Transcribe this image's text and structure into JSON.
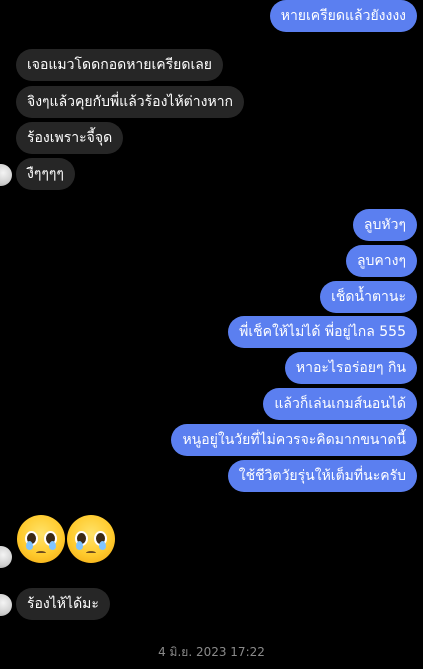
{
  "messages": {
    "m1": "หายเครียดแล้วยังงงง",
    "m2": "เจอแมวโดดกอดหายเครียดเลย",
    "m3": "จิงๆแล้วคุยกับพี่แล้วร้องไห้ต่างหาก",
    "m4": "ร้องเพราะจี้จุด",
    "m5": "งืๆๆๆๆ",
    "m6": "ลูบหัวๆ",
    "m7": "ลูบคางๆ",
    "m8": "เช็ดน้ำตานะ",
    "m9": "พี่เช็คให้ไม่ได้ พี่อยู่ไกล 555",
    "m10": "หาอะไรอร่อยๆ กิน",
    "m11": "แล้วก็เล่นเกมส์นอนได้",
    "m12": "หนูอยู่ในวัยที่ไม่ควรจะคิดมากขนาดนี้",
    "m13": "ใช้ชีวิตวัยรุ่นให้เต็มที่นะครับ",
    "m14": "ร้องไห้ได้มะ"
  },
  "emoji": [
    "pleading-face",
    "pleading-face"
  ],
  "timestamp": "4 มิ.ย. 2023 17:22",
  "colors": {
    "background": "#000000",
    "outgoing_bubble": "#5b7ff0",
    "incoming_bubble": "#262626",
    "timestamp_text": "#8a8a8a"
  }
}
